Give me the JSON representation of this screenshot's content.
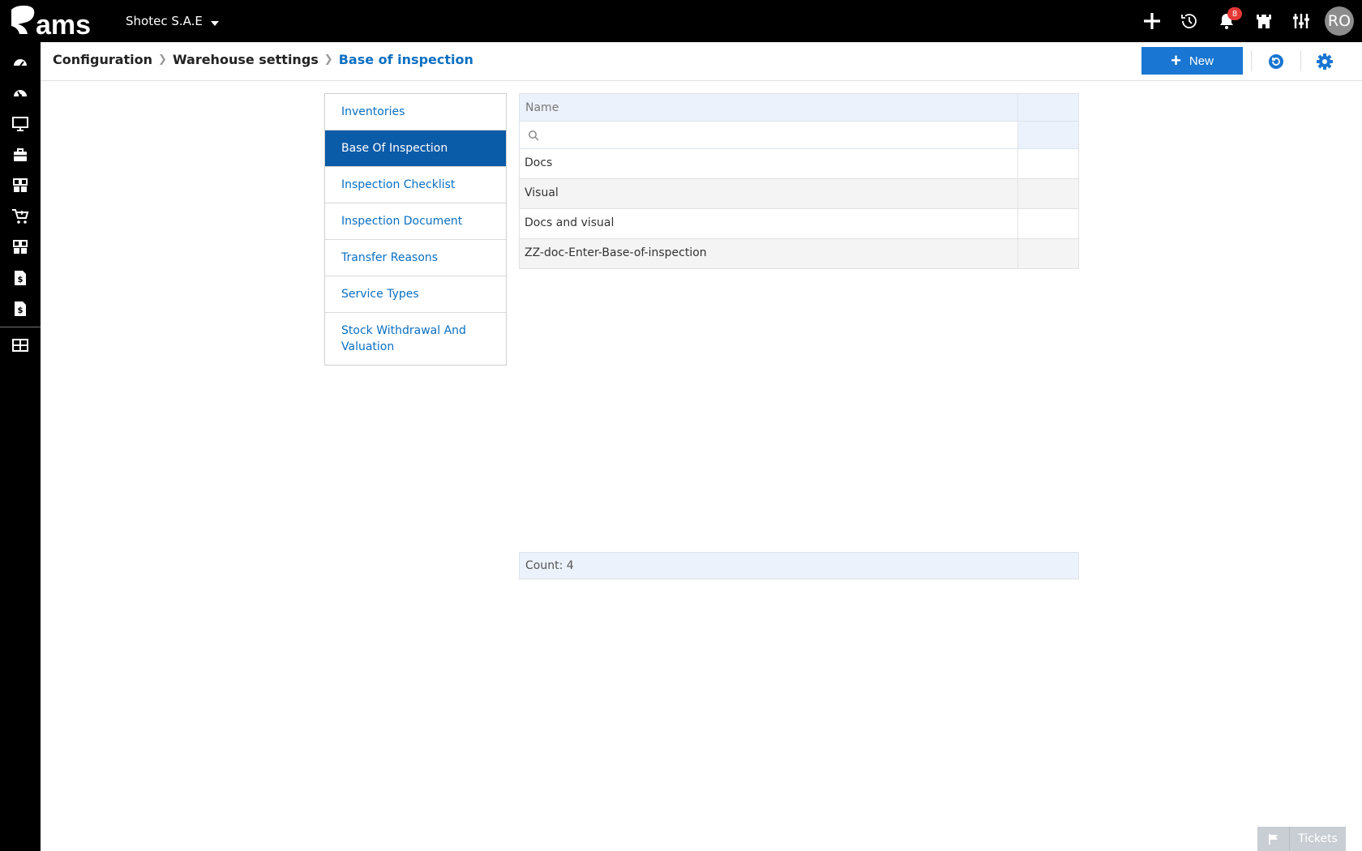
{
  "header": {
    "logo_text": "rams",
    "company": "Shotec S.A.E",
    "notification_count": "8",
    "avatar_initials": "RO"
  },
  "breadcrumb": {
    "items": [
      "Configuration",
      "Warehouse settings"
    ],
    "current": "Base of inspection"
  },
  "toolbar": {
    "new_label": "New"
  },
  "side_menu": {
    "items": [
      {
        "label": "Inventories"
      },
      {
        "label": "Base Of Inspection"
      },
      {
        "label": "Inspection Checklist"
      },
      {
        "label": "Inspection Document"
      },
      {
        "label": "Transfer Reasons"
      },
      {
        "label": "Service Types"
      },
      {
        "label": "Stock Withdrawal And Valuation"
      }
    ]
  },
  "grid": {
    "header_name": "Name",
    "search_placeholder": "",
    "rows": [
      {
        "name": "Docs"
      },
      {
        "name": "Visual"
      },
      {
        "name": "Docs and visual"
      },
      {
        "name": "ZZ-doc-Enter-Base-of-inspection"
      }
    ],
    "footer": "Count: 4"
  },
  "tickets": {
    "label": "Tickets"
  },
  "colors": {
    "topbar": "#000000",
    "accent": "#1976d2",
    "selected_menu": "#0a5ba8",
    "link": "#0a6fc2",
    "badge": "#e53935"
  }
}
